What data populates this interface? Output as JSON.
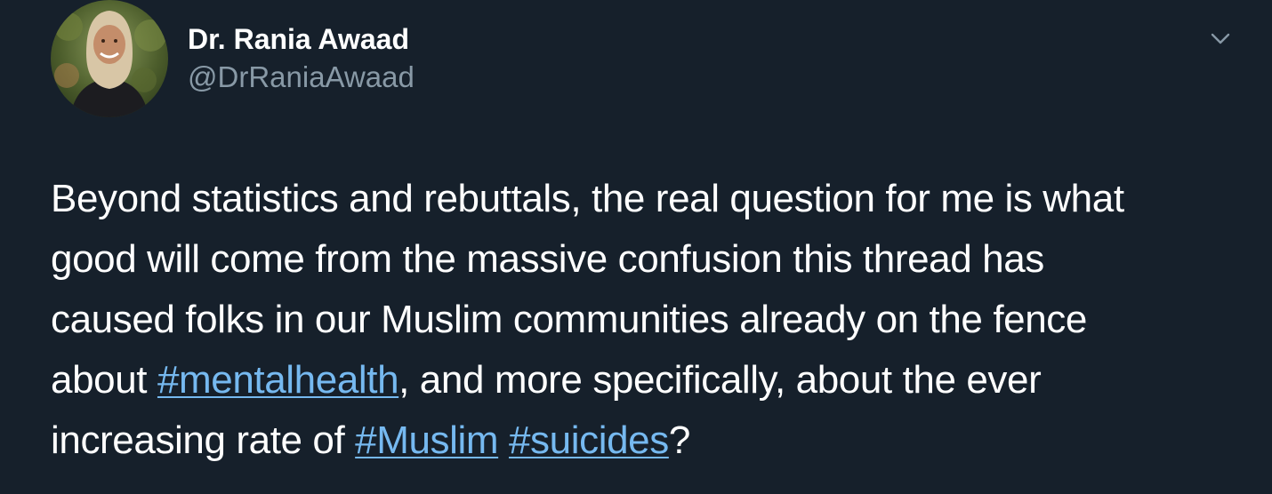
{
  "author": {
    "display_name": "Dr. Rania Awaad",
    "handle": "@DrRaniaAwaad",
    "avatar_icon": "profile-photo"
  },
  "menu": {
    "icon": "chevron-down-icon"
  },
  "tweet": {
    "line1": "Beyond statistics and rebuttals, the real question for me is what",
    "line2": "good will come from the massive confusion this thread has",
    "line3": "caused folks in our Muslim communities already on the fence",
    "line4_prefix": "about ",
    "hashtag_mentalhealth": "#mentalhealth",
    "line4_suffix": ", and more specifically, about the ever",
    "line5_prefix": "increasing rate of ",
    "hashtag_muslim": "#Muslim",
    "hashtag_sep": " ",
    "hashtag_suicides": "#suicides",
    "line5_suffix": "?"
  },
  "colors": {
    "background": "#16202b",
    "text": "#ffffff",
    "handle": "#8899a6",
    "hashtag": "#76b9f0"
  }
}
